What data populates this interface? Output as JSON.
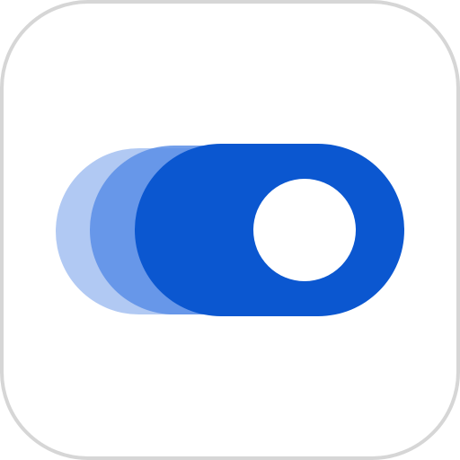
{
  "icon": {
    "name": "toggle-switch-icon",
    "state": "on",
    "colors": {
      "background": "#ffffff",
      "tile_border": "#d6d6d6",
      "track": "#0b57d0",
      "trail_near": "#5b8ee6",
      "trail_far": "#a9c3f2",
      "knob": "#ffffff"
    }
  }
}
